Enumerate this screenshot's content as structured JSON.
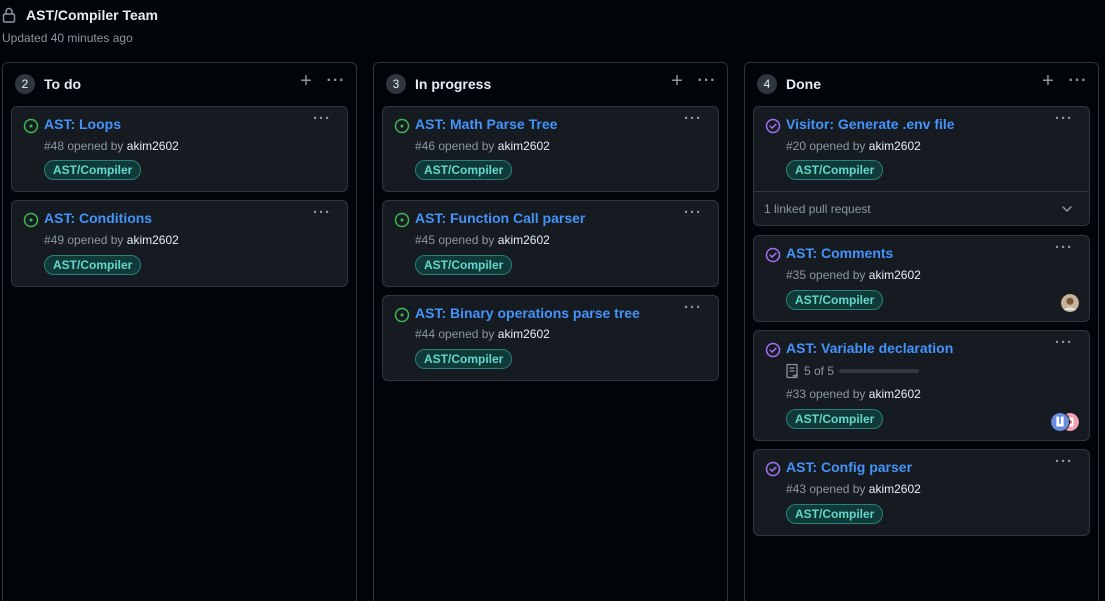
{
  "board": {
    "title": "AST/Compiler Team",
    "updated": "Updated 40 minutes ago"
  },
  "columns": [
    {
      "count": "2",
      "name": "To do",
      "cards": [
        {
          "title": "AST: Loops",
          "number": "#48",
          "opened_by": "opened by",
          "author": "akim2602",
          "label": "AST/Compiler"
        },
        {
          "title": "AST: Conditions",
          "number": "#49",
          "opened_by": "opened by",
          "author": "akim2602",
          "label": "AST/Compiler"
        }
      ]
    },
    {
      "count": "3",
      "name": "In progress",
      "cards": [
        {
          "title": "AST: Math Parse Tree",
          "number": "#46",
          "opened_by": "opened by",
          "author": "akim2602",
          "label": "AST/Compiler"
        },
        {
          "title": "AST: Function Call parser",
          "number": "#45",
          "opened_by": "opened by",
          "author": "akim2602",
          "label": "AST/Compiler"
        },
        {
          "title": "AST: Binary operations parse tree",
          "number": "#44",
          "opened_by": "opened by",
          "author": "akim2602",
          "label": "AST/Compiler"
        }
      ]
    },
    {
      "count": "4",
      "name": "Done",
      "cards": [
        {
          "title": "Visitor: Generate .env file",
          "number": "#20",
          "opened_by": "opened by",
          "author": "akim2602",
          "label": "AST/Compiler",
          "linked": "1 linked pull request"
        },
        {
          "title": "AST: Comments",
          "number": "#35",
          "opened_by": "opened by",
          "author": "akim2602",
          "label": "AST/Compiler"
        },
        {
          "title": "AST: Variable declaration",
          "number": "#33",
          "opened_by": "opened by",
          "author": "akim2602",
          "label": "AST/Compiler",
          "tasks": "5 of 5",
          "tasks_complete_fraction": 1.0
        },
        {
          "title": "AST: Config parser",
          "number": "#43",
          "opened_by": "opened by",
          "author": "akim2602",
          "label": "AST/Compiler"
        }
      ]
    }
  ],
  "icons": {
    "lock": "lock-icon",
    "open_issue": "issue-opened-icon",
    "closed_issue": "issue-closed-icon",
    "add": "plus-icon",
    "more": "kebab-horizontal-icon",
    "chevron": "chevron-down-icon",
    "tasklist": "tasklist-icon"
  },
  "colors": {
    "background": "#010409",
    "card": "#161b22",
    "border": "#30363d",
    "link": "#4493f8",
    "open": "#3fb950",
    "closed": "#a371f7",
    "label_text": "#64d6cb",
    "label_bg": "#0f3a37"
  }
}
